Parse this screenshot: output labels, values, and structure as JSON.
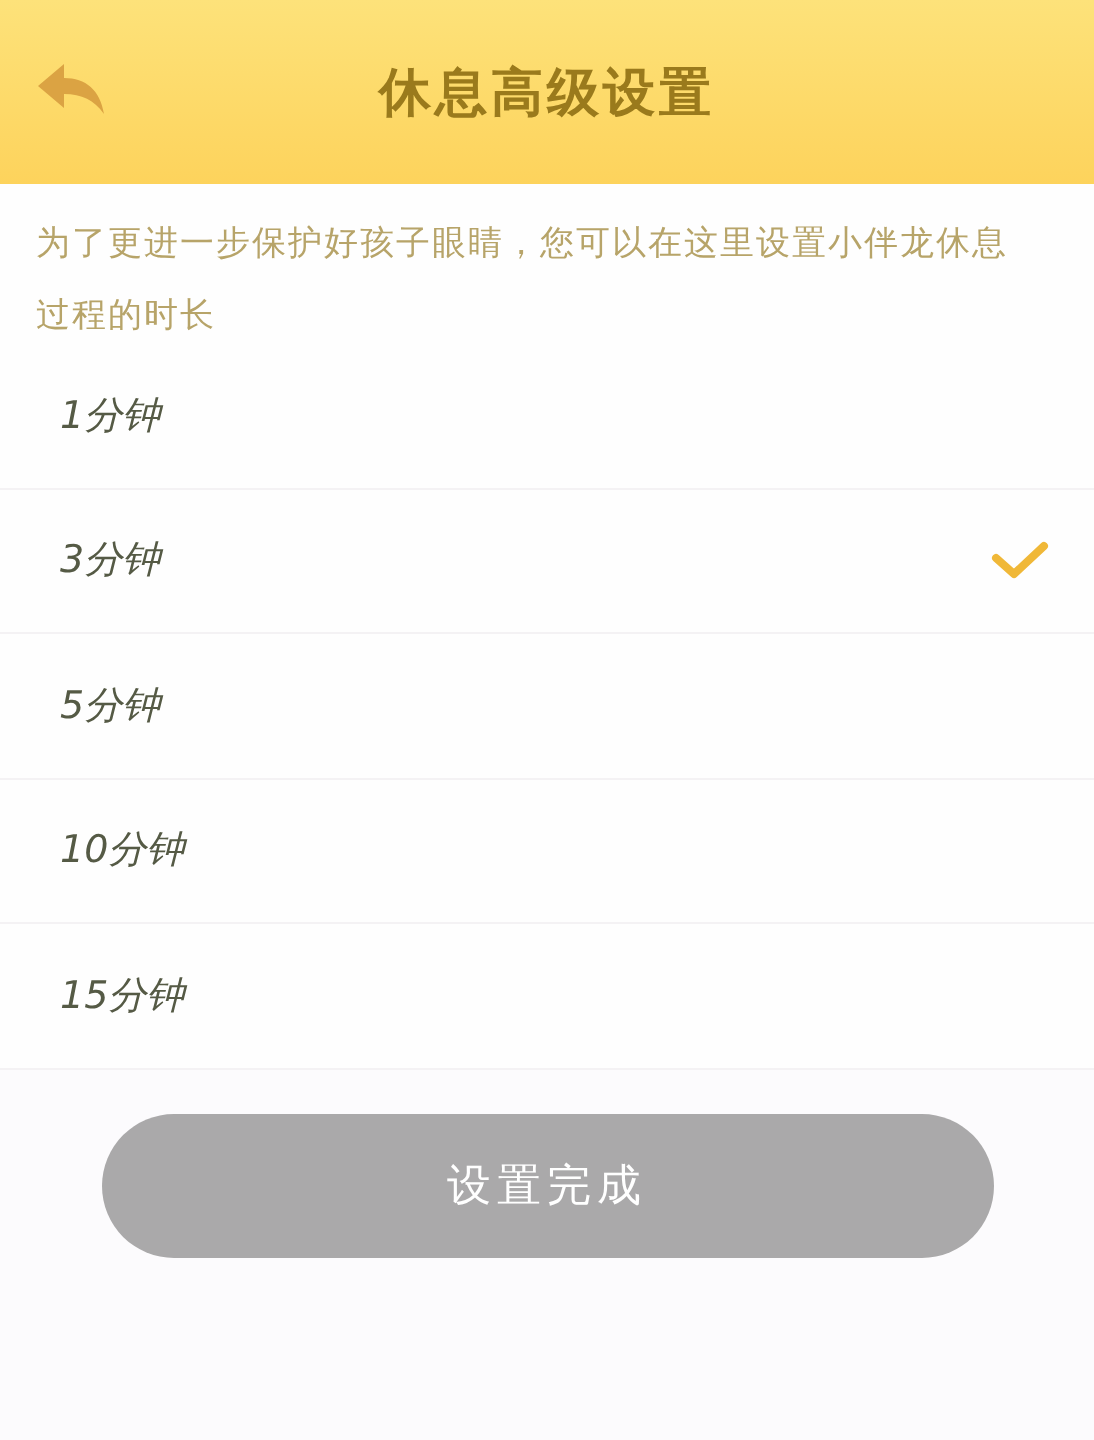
{
  "header": {
    "title": "休息高级设置"
  },
  "description": "为了更进一步保护好孩子眼睛，您可以在这里设置小伴龙休息过程的时长",
  "options": [
    {
      "label": "1分钟",
      "selected": false
    },
    {
      "label": "3分钟",
      "selected": true
    },
    {
      "label": "5分钟",
      "selected": false
    },
    {
      "label": "10分钟",
      "selected": false
    },
    {
      "label": "15分钟",
      "selected": false
    }
  ],
  "done_button": "设置完成"
}
